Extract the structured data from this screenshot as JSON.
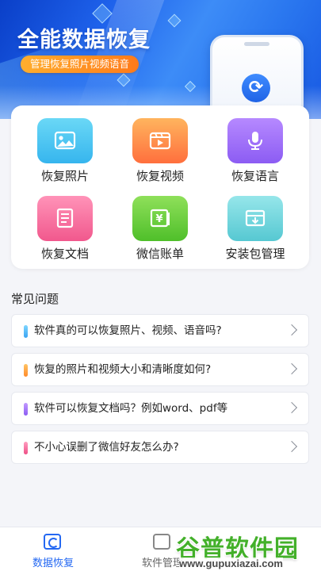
{
  "banner": {
    "title": "全能数据恢复",
    "tag": "管理恢复照片视频语音"
  },
  "features": [
    {
      "label": "恢复照片",
      "icon": "photo-icon",
      "color": "#36b5ee"
    },
    {
      "label": "恢复视频",
      "icon": "video-icon",
      "color": "#ff6f3d"
    },
    {
      "label": "恢复语言",
      "icon": "microphone-icon",
      "color": "#8c5cf3"
    },
    {
      "label": "恢复文档",
      "icon": "document-icon",
      "color": "#f1588d"
    },
    {
      "label": "微信账单",
      "icon": "yen-bill-icon",
      "color": "#4fbf2a"
    },
    {
      "label": "安装包管理",
      "icon": "package-icon",
      "color": "#56c8d2"
    }
  ],
  "faq": {
    "title": "常见问题",
    "items": [
      {
        "question": "软件真的可以恢复照片、视频、语音吗?",
        "bar_color": "#4fb8f5"
      },
      {
        "question": "恢复的照片和视频大小和清晰度如何?",
        "bar_color": "#ffa640"
      },
      {
        "question": "软件可以恢复文档吗？例如word、pdf等",
        "bar_color": "#9a6cf6"
      },
      {
        "question": "不小心误删了微信好友怎么办?",
        "bar_color": "#f2608f"
      }
    ]
  },
  "nav": {
    "items": [
      {
        "label": "数据恢复",
        "active": true
      },
      {
        "label": "软件管理",
        "active": false
      }
    ]
  },
  "watermark": {
    "logo": "谷普软件园",
    "url": "www.gupuxiazai.com"
  },
  "colors": {
    "accent": "#2468f2",
    "banner": "#1f63ec"
  }
}
